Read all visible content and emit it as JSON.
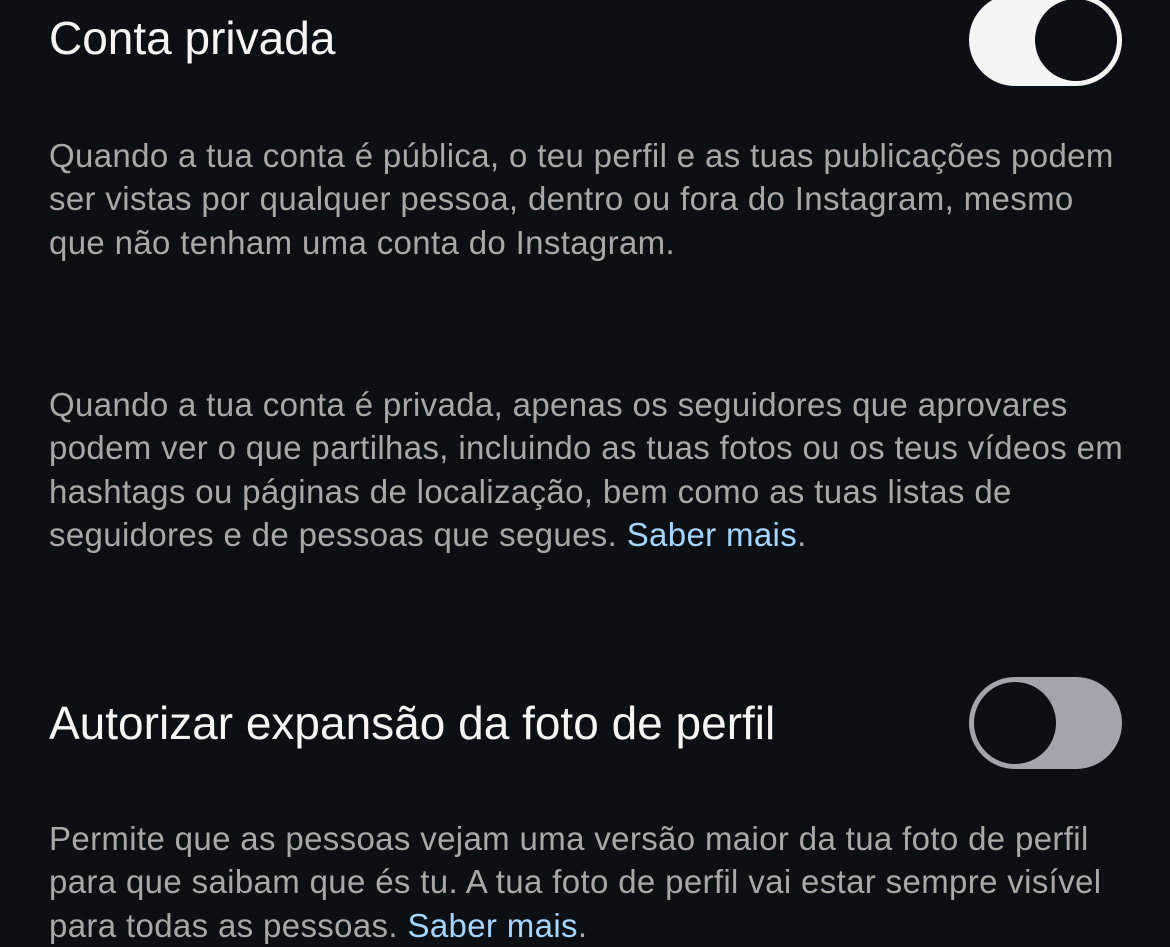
{
  "private_account": {
    "title": "Conta privada",
    "toggle_on": true,
    "desc_public": "Quando a tua conta é pública, o teu perfil e as tuas publicações podem ser vistas por qualquer pessoa, dentro ou fora do Instagram, mesmo que não tenham uma conta do Instagram.",
    "desc_private": "Quando a tua conta é privada, apenas os seguidores que aprovares podem ver o que partilhas, incluindo as tuas fotos ou os teus vídeos em hashtags ou páginas de localização, bem como as tuas listas de seguidores e de pessoas que segues.",
    "learn_more": "Saber mais",
    "learn_more_suffix": "."
  },
  "profile_photo_expansion": {
    "title": "Autorizar expansão da foto de perfil",
    "toggle_on": false,
    "desc": "Permite que as pessoas vejam uma versão maior da tua foto de perfil para que saibam que és tu. A tua foto de perfil vai estar sempre visível para todas as pessoas.",
    "learn_more": "Saber mais",
    "learn_more_suffix": "."
  },
  "colors": {
    "background": "#0c1014",
    "primary_text": "#f5f5f5",
    "secondary_text": "#a8a8a8",
    "link": "#a4d6ff",
    "toggle_on_track": "#f5f5f5",
    "toggle_off_track": "#a2a5ab"
  }
}
